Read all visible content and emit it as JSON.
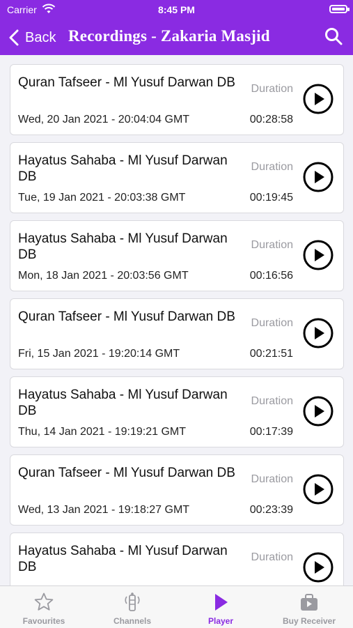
{
  "status_bar": {
    "carrier": "Carrier",
    "time": "8:45 PM"
  },
  "nav": {
    "back_label": "Back",
    "title": "Recordings - Zakaria Masjid"
  },
  "recordings": [
    {
      "title": "Quran Tafseer - Ml Yusuf Darwan DB",
      "date": "Wed, 20 Jan 2021 - 20:04:04 GMT",
      "duration_label": "Duration",
      "duration": "00:28:58"
    },
    {
      "title": "Hayatus Sahaba - Ml Yusuf Darwan DB",
      "date": "Tue, 19 Jan 2021 - 20:03:38 GMT",
      "duration_label": "Duration",
      "duration": "00:19:45"
    },
    {
      "title": "Hayatus Sahaba - Ml Yusuf Darwan DB",
      "date": "Mon, 18 Jan 2021 - 20:03:56 GMT",
      "duration_label": "Duration",
      "duration": "00:16:56"
    },
    {
      "title": "Quran Tafseer - Ml Yusuf Darwan DB",
      "date": "Fri, 15 Jan 2021 - 19:20:14 GMT",
      "duration_label": "Duration",
      "duration": "00:21:51"
    },
    {
      "title": "Hayatus Sahaba - Ml Yusuf Darwan DB",
      "date": "Thu, 14 Jan 2021 - 19:19:21 GMT",
      "duration_label": "Duration",
      "duration": "00:17:39"
    },
    {
      "title": "Quran Tafseer - Ml Yusuf Darwan DB",
      "date": "Wed, 13 Jan 2021 - 19:18:27 GMT",
      "duration_label": "Duration",
      "duration": "00:23:39"
    },
    {
      "title": "Hayatus Sahaba - Ml Yusuf Darwan DB",
      "date": "",
      "duration_label": "Duration",
      "duration": ""
    }
  ],
  "tabs": [
    {
      "label": "Favourites",
      "icon": "star-icon",
      "active": false
    },
    {
      "label": "Channels",
      "icon": "radio-tower-icon",
      "active": false
    },
    {
      "label": "Player",
      "icon": "play-icon",
      "active": true
    },
    {
      "label": "Buy Receiver",
      "icon": "shopping-bag-icon",
      "active": false
    }
  ],
  "colors": {
    "accent": "#8a2be2",
    "inactive": "#9a9aa0"
  }
}
